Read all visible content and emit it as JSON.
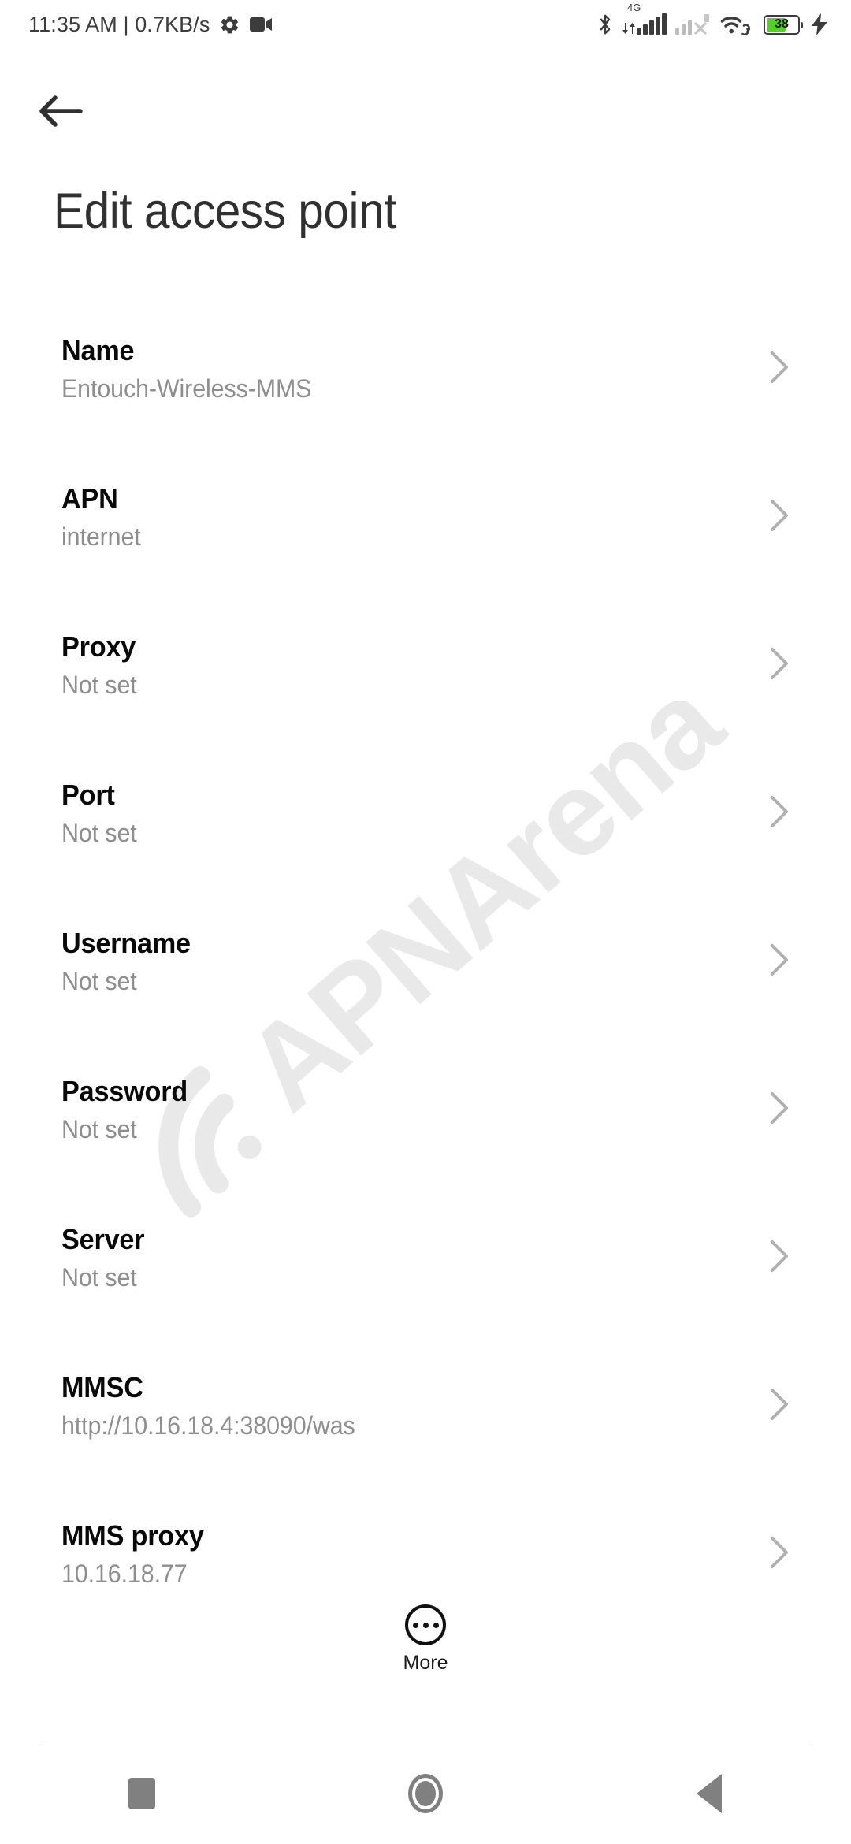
{
  "status_bar": {
    "clock": "11:35 AM | 0.7KB/s",
    "network_label": "4G",
    "battery_percent": "38",
    "battery_color": "#55d024",
    "icons": [
      "gear-icon",
      "video-camera-icon",
      "bluetooth-icon",
      "signal-sim1-icon",
      "signal-sim2-icon",
      "wifi-icon",
      "battery-icon",
      "charging-bolt-icon"
    ]
  },
  "app_bar": {
    "back_label": "Back",
    "title": "Edit access point"
  },
  "watermark": {
    "text": "APNArena",
    "color": "#e9e9e9"
  },
  "settings": {
    "rows": [
      {
        "title": "Name",
        "value": "Entouch-Wireless-MMS"
      },
      {
        "title": "APN",
        "value": "internet"
      },
      {
        "title": "Proxy",
        "value": "Not set"
      },
      {
        "title": "Port",
        "value": "Not set"
      },
      {
        "title": "Username",
        "value": "Not set"
      },
      {
        "title": "Password",
        "value": "Not set"
      },
      {
        "title": "Server",
        "value": "Not set"
      },
      {
        "title": "MMSC",
        "value": "http://10.16.18.4:38090/was"
      },
      {
        "title": "MMS proxy",
        "value": "10.16.18.77"
      }
    ]
  },
  "more_button": {
    "label": "More"
  },
  "nav_bar": {
    "recent_label": "Recent apps",
    "home_label": "Home",
    "back_label": "Back"
  }
}
